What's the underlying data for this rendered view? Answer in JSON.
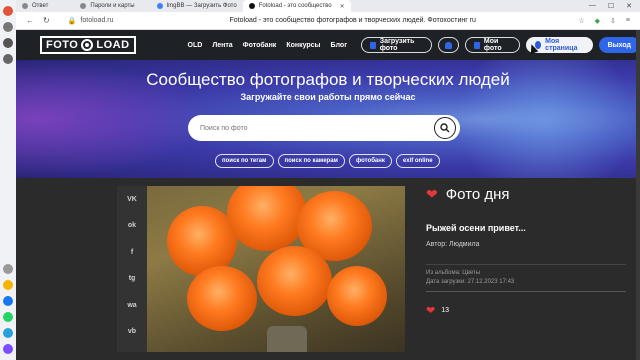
{
  "browser": {
    "tabs": [
      {
        "label": "Ответ"
      },
      {
        "label": "Пароли и карты"
      },
      {
        "label": "ImgBB — Загрузить Фото"
      },
      {
        "label": "Fotoload - это сообщество"
      }
    ],
    "url": "fotoload.ru",
    "page_title": "Fotoload - это сообщество фотографов и творческих людей. Фотохостинг ru"
  },
  "site": {
    "logo_left": "FOTO",
    "logo_right": "LOAD",
    "menu": [
      "OLD",
      "Лента",
      "Фотобанк",
      "Конкурсы",
      "Блог"
    ],
    "upload_label": "Загрузить фото",
    "myphoto_label": "Мои фото",
    "mypage_label": "Моя страница",
    "login_label": "Выход"
  },
  "hero": {
    "title": "Сообщество фотографов и творческих людей",
    "subtitle": "Загружайте свои работы прямо сейчас",
    "search_placeholder": "Поиск по фото",
    "tags": [
      "поиск по тегам",
      "поиск по камерам",
      "фотобанк",
      "exif online"
    ]
  },
  "share_icons": [
    "VK",
    "ok",
    "f",
    "tg",
    "wa",
    "vb"
  ],
  "photo_of_day": {
    "heading": "Фото дня",
    "title": "Рыжей осени привет...",
    "author": "Автор: Людмила",
    "album": "Из альбома: Цветы",
    "date": "Дата загрузки: 27.12.2023 17:43",
    "likes": "13"
  },
  "colors": {
    "header_bg": "#1e2126",
    "accent_blue": "#2f66e8",
    "heart_red": "#e53838",
    "content_bg": "#2b2b2b"
  }
}
